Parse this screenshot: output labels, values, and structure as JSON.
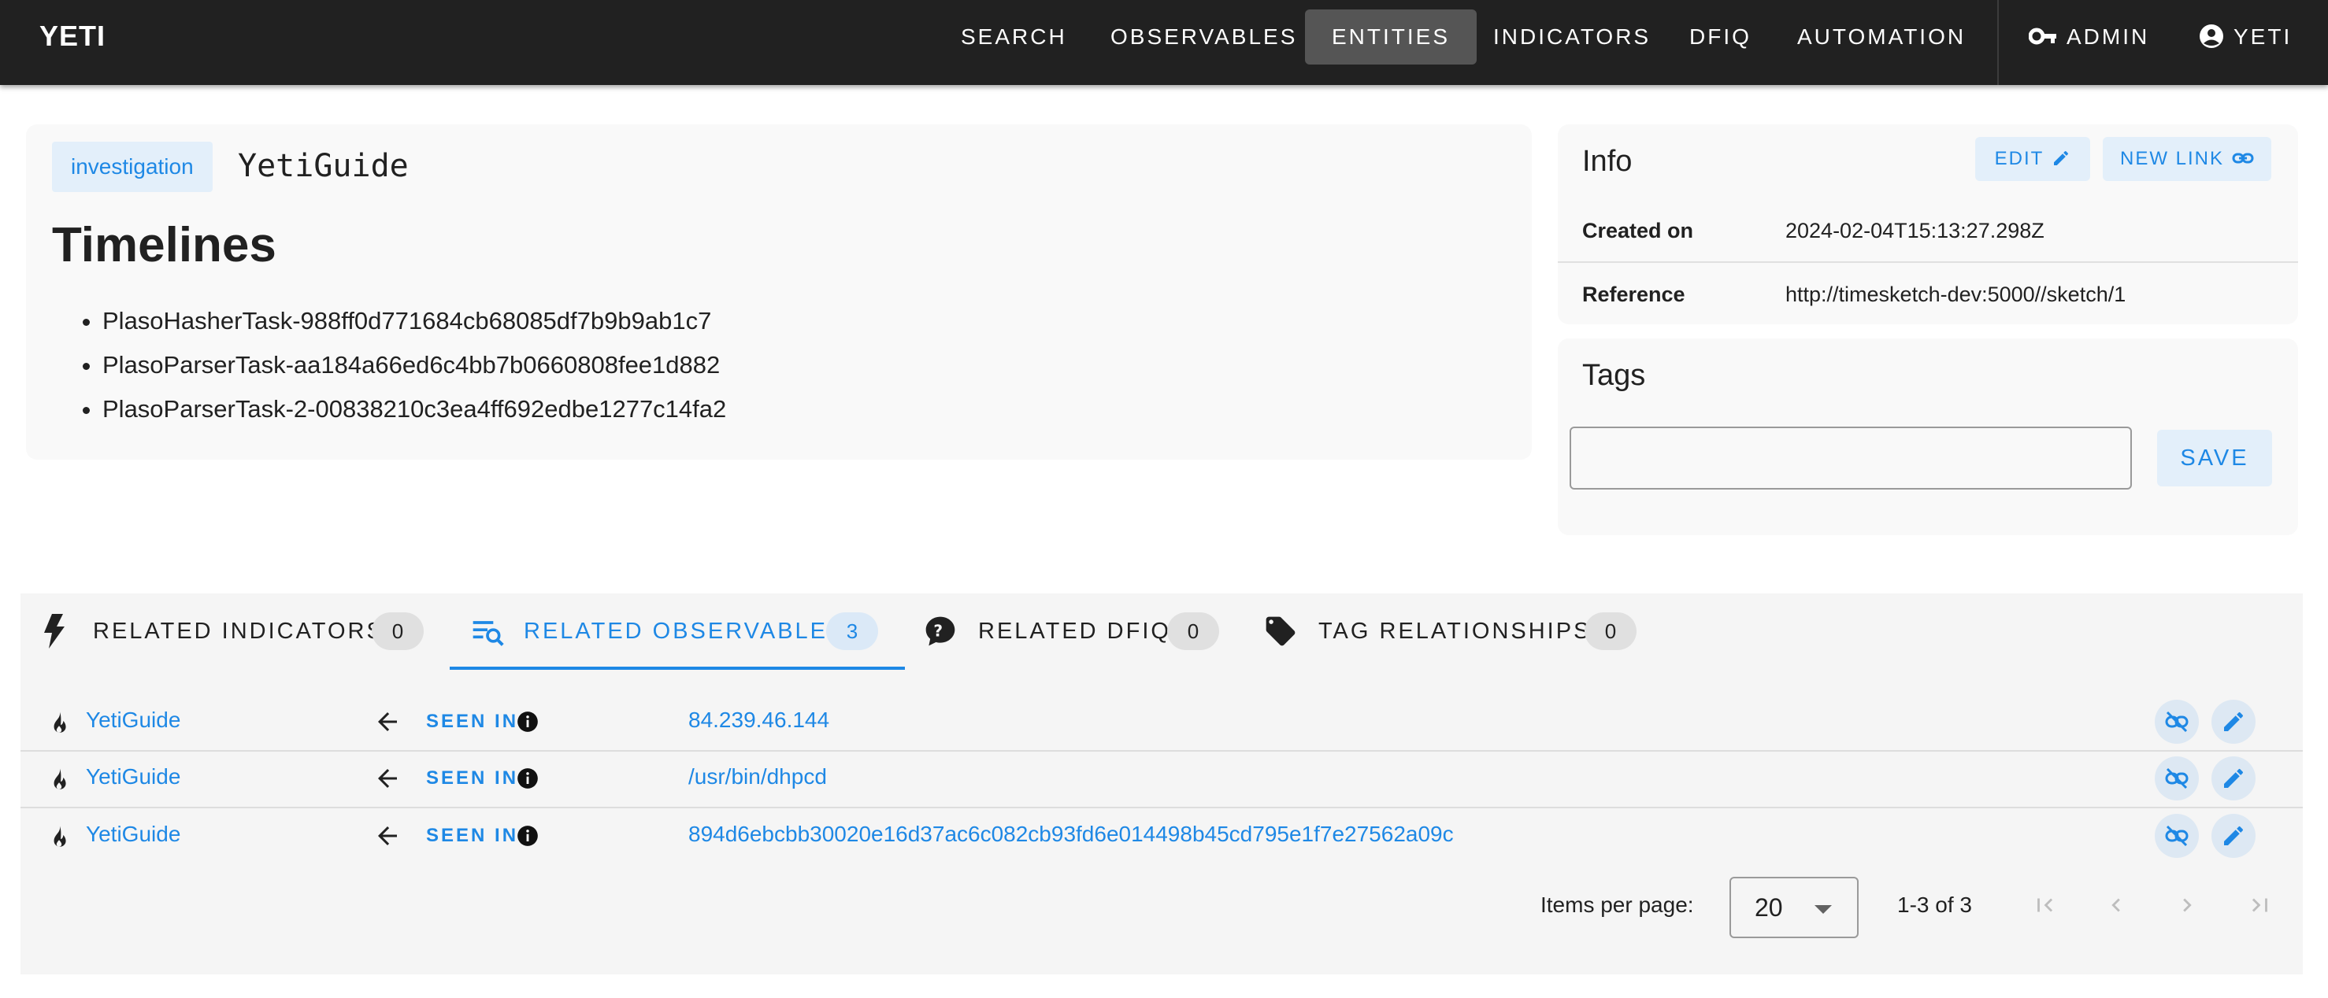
{
  "app": {
    "brand": "YETI"
  },
  "nav": {
    "items": [
      {
        "label": "SEARCH"
      },
      {
        "label": "OBSERVABLES"
      },
      {
        "label": "ENTITIES",
        "active": true
      },
      {
        "label": "INDICATORS"
      },
      {
        "label": "DFIQ"
      },
      {
        "label": "AUTOMATION"
      }
    ],
    "admin_label": "ADMIN",
    "user_label": "YETI"
  },
  "entity": {
    "type": "investigation",
    "name": "YetiGuide",
    "section_title": "Timelines",
    "timelines": [
      "PlasoHasherTask-988ff0d771684cb68085df7b9b9ab1c7",
      "PlasoParserTask-aa184a66ed6c4bb7b0660808fee1d882",
      "PlasoParserTask-2-00838210c3ea4ff692edbe1277c14fa2"
    ]
  },
  "info": {
    "title": "Info",
    "edit_label": "EDIT",
    "new_link_label": "NEW LINK",
    "fields": [
      {
        "label": "Created on",
        "value": "2024-02-04T15:13:27.298Z"
      },
      {
        "label": "Reference",
        "value": "http://timesketch-dev:5000//sketch/1"
      }
    ]
  },
  "tags": {
    "title": "Tags",
    "input_value": "",
    "save_label": "SAVE"
  },
  "relations": {
    "tabs": [
      {
        "label": "RELATED INDICATORS",
        "count": "0",
        "icon": "bolt-icon"
      },
      {
        "label": "RELATED OBSERVABLES",
        "count": "3",
        "icon": "search-list-icon",
        "active": true
      },
      {
        "label": "RELATED DFIQ",
        "count": "0",
        "icon": "question-chat-icon"
      },
      {
        "label": "TAG RELATIONSHIPS",
        "count": "0",
        "icon": "tag-icon"
      }
    ],
    "rows": [
      {
        "source": "YetiGuide",
        "relation": "SEEN IN",
        "target": "84.239.46.144"
      },
      {
        "source": "YetiGuide",
        "relation": "SEEN IN",
        "target": "/usr/bin/dhpcd"
      },
      {
        "source": "YetiGuide",
        "relation": "SEEN IN",
        "target": "894d6ebcbb30020e16d37ac6c082cb93fd6e014498b45cd795e1f7e27562a09c"
      }
    ],
    "pagination": {
      "items_per_page_label": "Items per page:",
      "items_per_page": "20",
      "range": "1-3 of 3"
    }
  },
  "colors": {
    "accent": "#1e88e5",
    "topbar": "#212121",
    "active_nav": "#555555"
  }
}
